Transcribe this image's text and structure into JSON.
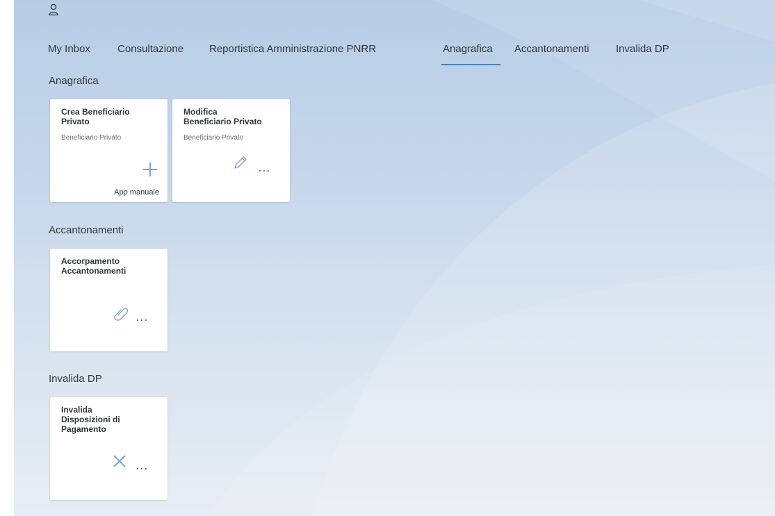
{
  "tabs": [
    {
      "label": "My Inbox"
    },
    {
      "label": "Consultazione"
    },
    {
      "label": "Reportistica Amministrazione PNRR"
    },
    {
      "label": "Anagrafica",
      "selected": true
    },
    {
      "label": "Accantonamenti"
    },
    {
      "label": "Invalida DP"
    }
  ],
  "sections": [
    {
      "title": "Anagrafica",
      "tiles": [
        {
          "title": "Crea Beneficiario\nPrivato",
          "subtitle": "Beneficiario Privato",
          "icon": "plus-icon",
          "footer": "App manuale"
        },
        {
          "title": "Modifica\nBeneficiario Privato",
          "subtitle": "Beneficiario Privato",
          "icon": "pencil-icon",
          "more": "..."
        }
      ]
    },
    {
      "title": "Accantonamenti",
      "tiles": [
        {
          "title": "Accorpamento\nAccantonamenti",
          "icon": "link-icon",
          "more": "..."
        }
      ]
    },
    {
      "title": "Invalida DP",
      "tiles": [
        {
          "title": "Invalida\nDisposizioni di\nPagamento",
          "icon": "cross-icon",
          "more": "..."
        }
      ]
    }
  ],
  "colors": {
    "accent": "#4d80b3",
    "icon": "#7aa4d2",
    "background_top": "#b7cde6",
    "background_bottom": "#e7edf4"
  }
}
